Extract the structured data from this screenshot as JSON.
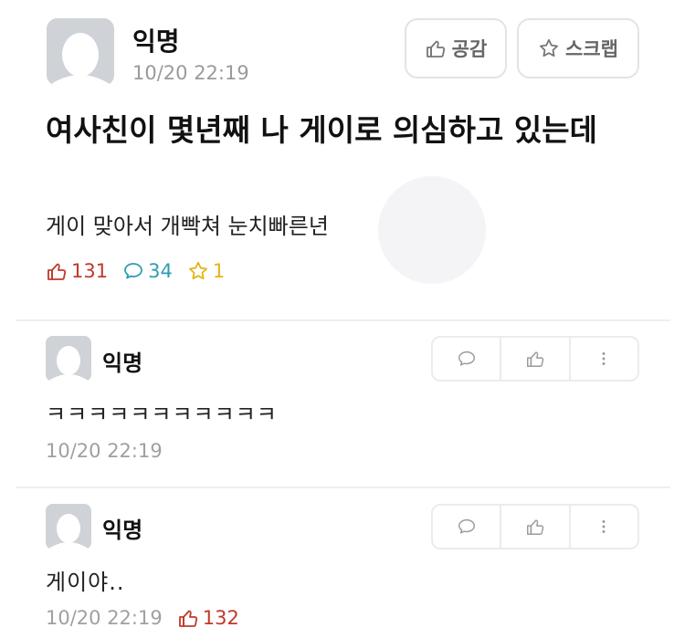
{
  "post": {
    "author": "익명",
    "time": "10/20 22:19",
    "like_button_label": "공감",
    "scrap_button_label": "스크랩",
    "title": "여사친이 몇년째 나 게이로 의심하고 있는데",
    "body": "게이 맞아서 개빡쳐 눈치빠른년",
    "stats": {
      "likes": "131",
      "comments": "34",
      "scraps": "1"
    },
    "icons": {
      "like": "thumbs-up-icon",
      "comment": "speech-bubble-icon",
      "scrap": "star-icon"
    },
    "colors": {
      "likes": "#c0392b",
      "comments": "#2e9db3",
      "scraps": "#e2b514"
    }
  },
  "comments": [
    {
      "author": "익명",
      "text": "ㅋㅋㅋㅋㅋㅋㅋㅋㅋㅋㅋ",
      "time": "10/20 22:19"
    },
    {
      "author": "익명",
      "text": "게이야..",
      "time": "10/20 22:19",
      "likes": "132"
    }
  ]
}
